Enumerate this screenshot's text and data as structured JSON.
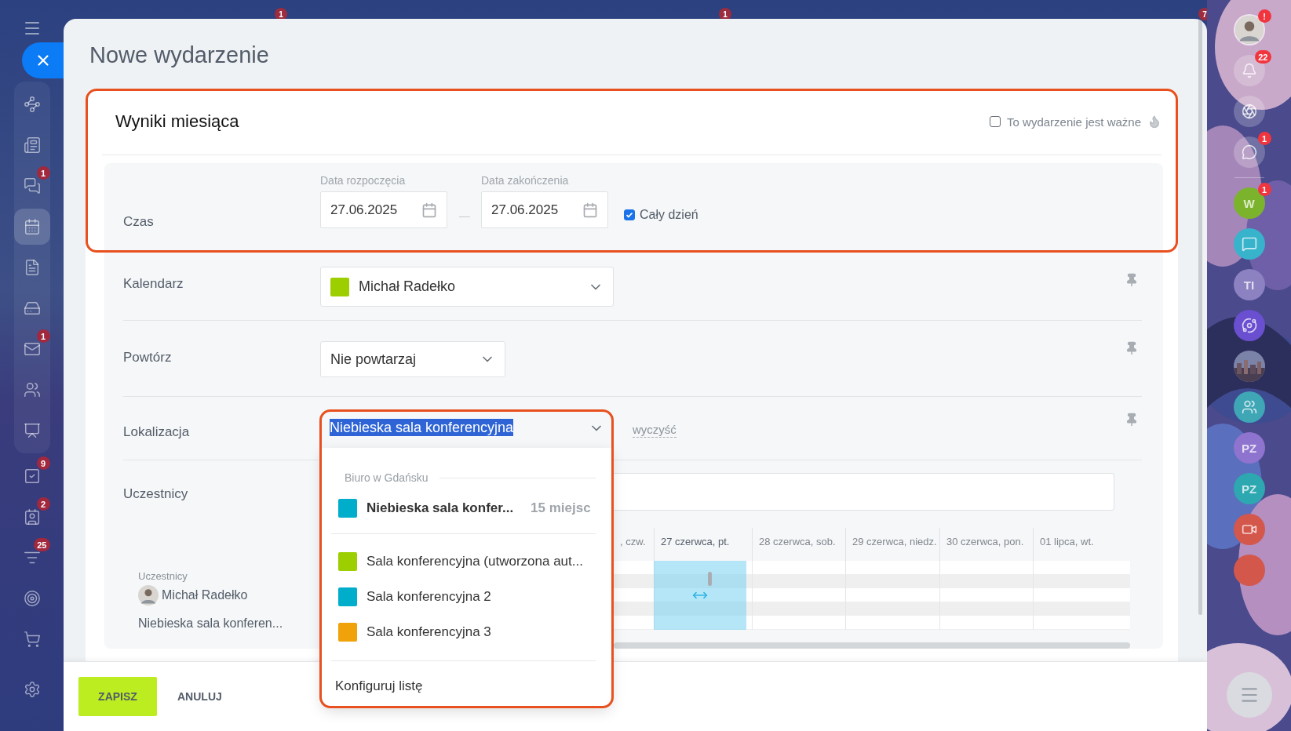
{
  "background_badges": [
    "1",
    "1",
    "7"
  ],
  "left_sidebar": {
    "items": [
      {
        "selected": false
      },
      {
        "selected": false
      },
      {
        "selected": false,
        "badge": "1"
      },
      {
        "selected": true
      },
      {
        "selected": false
      },
      {
        "selected": false
      },
      {
        "selected": false,
        "badge": "1"
      },
      {
        "selected": false
      },
      {
        "selected": false
      },
      {
        "selected": false,
        "badge": "9"
      },
      {
        "selected": false,
        "badge": "2"
      },
      {
        "selected": false,
        "badge": "25"
      },
      {
        "selected": false
      },
      {
        "selected": false
      },
      {
        "selected": false
      }
    ]
  },
  "panel": {
    "title": "Nowe wydarzenie",
    "event_name": "Wyniki miesiąca",
    "important": {
      "label": "To wydarzenie jest ważne",
      "checked": false
    },
    "time": {
      "label": "Czas",
      "start_label": "Data rozpoczęcia",
      "start": "27.06.2025",
      "end_label": "Data zakończenia",
      "end": "27.06.2025",
      "all_day": {
        "label": "Cały dzień",
        "checked": true
      }
    },
    "calendar": {
      "label": "Kalendarz",
      "value": "Michał Radełko",
      "color": "#9dcf00"
    },
    "repeat": {
      "label": "Powtórz",
      "value": "Nie powtarzaj"
    },
    "location": {
      "label": "Lokalizacja",
      "value": "Niebieska sala konferencyjna",
      "clear": "wyczyść"
    },
    "participants": {
      "label": "Uczestnicy"
    },
    "planner": {
      "columns": [
        {
          "label": ", czw.",
          "selected": false
        },
        {
          "label": "27 czerwca, pt.",
          "selected": true
        },
        {
          "label": "28 czerwca, sob.",
          "selected": false
        },
        {
          "label": "29 czerwca, niedz.",
          "selected": false
        },
        {
          "label": "30 czerwca, pon.",
          "selected": false
        },
        {
          "label": "01 lipca, wt.",
          "selected": false
        }
      ],
      "rows_label": "Uczestnicy",
      "people": [
        "Michał Radełko"
      ],
      "rooms": [
        "Niebieska sala konferen..."
      ]
    },
    "footer": {
      "save": "ZAPISZ",
      "cancel": "ANULUJ"
    }
  },
  "location_menu": {
    "group": "Biuro w Gdańsku",
    "items": [
      {
        "name": "Niebieska sala konfer...",
        "capacity": "15 miejsc",
        "color": "#00aecb",
        "selected": true
      },
      {
        "name": "Sala konferencyjna (utworzona aut...",
        "color": "#9dcf00",
        "selected": false
      },
      {
        "name": "Sala konferencyjna 2",
        "color": "#00aecb",
        "selected": false
      },
      {
        "name": "Sala konferencyjna 3",
        "color": "#f0a20a",
        "selected": false
      }
    ],
    "configure": "Konfiguruj listę"
  },
  "right_sidebar": {
    "items": [
      {
        "kind": "avatar",
        "badge": "!"
      },
      {
        "kind": "icon",
        "badge": "22"
      },
      {
        "kind": "icon"
      },
      {
        "kind": "icon",
        "badge": "1"
      },
      {
        "kind": "divider"
      },
      {
        "kind": "letter",
        "text": "W",
        "color": "#7bb42c",
        "badge": "1"
      },
      {
        "kind": "icon",
        "color": "#38b3cc"
      },
      {
        "kind": "letter",
        "text": "TI",
        "color": "#8c82c2"
      },
      {
        "kind": "icon",
        "color": "#6a4fd0"
      },
      {
        "kind": "picture"
      },
      {
        "kind": "icon",
        "color": "#3fa6b6"
      },
      {
        "kind": "letter",
        "text": "PZ",
        "color": "#8f74cf"
      },
      {
        "kind": "letter",
        "text": "PZ",
        "color": "#2ea8b0"
      },
      {
        "kind": "icon",
        "color": "#d4574c"
      },
      {
        "kind": "circle",
        "color": "#d4574c"
      }
    ]
  }
}
